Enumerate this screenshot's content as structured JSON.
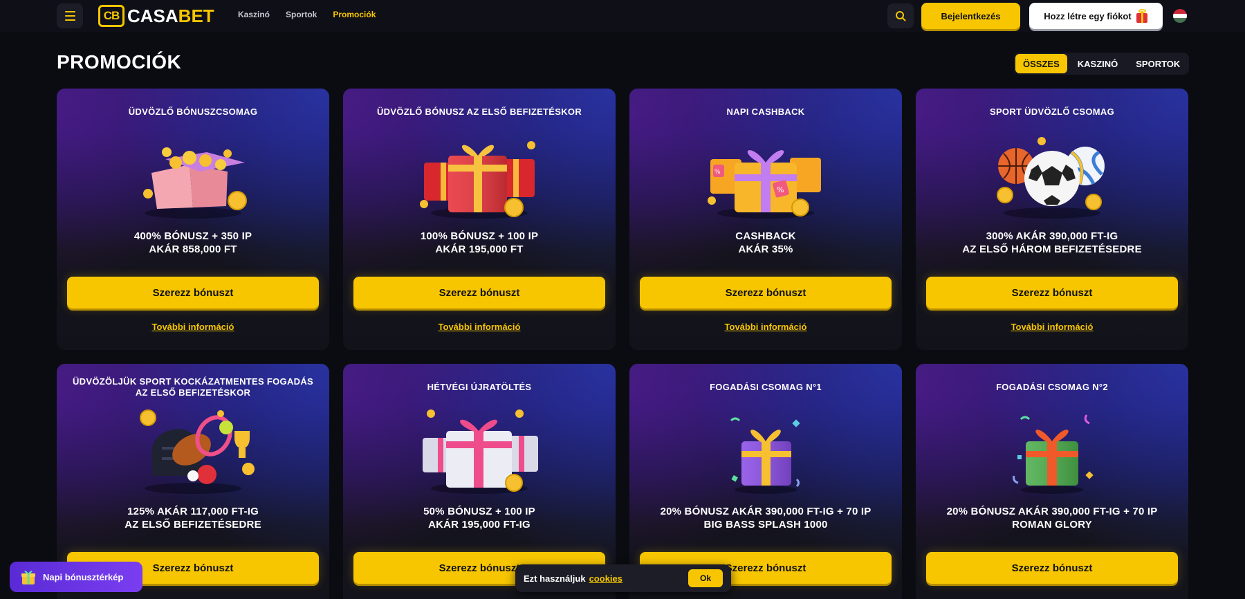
{
  "header": {
    "logo_mark": "CB",
    "logo_casa": "CASA",
    "logo_bet": "BET",
    "nav": [
      "Kaszinó",
      "Sportok",
      "Promociók"
    ],
    "login_label": "Bejelentkezés",
    "register_label": "Hozz létre egy fiókot"
  },
  "page": {
    "title": "PROMOCIÓK",
    "filters": [
      "ÖSSZES",
      "KASZINÓ",
      "SPORTOK"
    ],
    "active_filter": "ÖSSZES"
  },
  "cards": [
    {
      "title": "ÜDVÖZLŐ BÓNUSZCSOMAG",
      "desc": "400% BÓNUSZ + 350 IP\nAKÁR 858,000 FT",
      "button": "Szerezz bónuszt",
      "link": "További információ",
      "art": "treasure-chests-icon"
    },
    {
      "title": "ÜDVÖZLŐ BÓNUSZ AZ ELSŐ BEFIZETÉSKOR",
      "desc": "100% BÓNUSZ + 100 IP\nAKÁR 195,000 FT",
      "button": "Szerezz bónuszt",
      "link": "További információ",
      "art": "red-gift-boxes-icon"
    },
    {
      "title": "NAPI CASHBACK",
      "desc": "CASHBACK\nAKÁR 35%",
      "button": "Szerezz bónuszt",
      "link": "További információ",
      "art": "cashback-gifts-icon"
    },
    {
      "title": "SPORT ÜDVÖZLŐ CSOMAG",
      "desc": "300% AKÁR 390,000 FT-IG\nAZ ELSŐ HÁROM BEFIZETÉSEDRE",
      "button": "Szerezz bónuszt",
      "link": "További információ",
      "art": "sports-balls-icon"
    },
    {
      "title": "ÜDVÖZÖLJÜK SPORT KOCKÁZATMENTES FOGADÁS\nAZ ELSŐ BEFIZETÉSKOR",
      "desc": "125% AKÁR 117,000 FT-IG\nAZ ELSŐ BEFIZETÉSEDRE",
      "button": "Szerezz bónuszt",
      "link": "",
      "art": "sports-gear-icon"
    },
    {
      "title": "HÉTVÉGI ÚJRATÖLTÉS",
      "desc": "50% BÓNUSZ + 100 IP\nAKÁR 195,000 FT-IG",
      "button": "Szerezz bónuszt",
      "link": "",
      "art": "white-gift-boxes-icon"
    },
    {
      "title": "FOGADÁSI CSOMAG N°1",
      "desc": "20% BÓNUSZ AKÁR 390,000 FT-IG + 70 IP\nBIG BASS SPLASH 1000",
      "button": "Szerezz bónuszt",
      "link": "",
      "art": "purple-gift-icon"
    },
    {
      "title": "FOGADÁSI CSOMAG N°2",
      "desc": "20% BÓNUSZ AKÁR 390,000 FT-IG + 70 IP\nROMAN GLORY",
      "button": "Szerezz bónuszt",
      "link": "",
      "art": "green-gift-icon"
    }
  ],
  "widgets": {
    "daily_map_label": "Napi bónusztérkép",
    "cookie_text": "Ezt használjuk",
    "cookie_link": "cookies",
    "cookie_ok": "Ok"
  },
  "colors": {
    "accent": "#f7c600",
    "background": "#0b0c12",
    "flag": [
      "#ce2939",
      "#ffffff",
      "#477050"
    ]
  }
}
